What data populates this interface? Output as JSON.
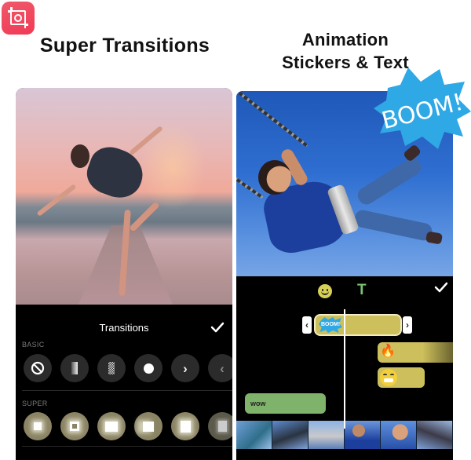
{
  "app": {
    "logo_icon": "instashot-crop-camera-icon"
  },
  "left_feature": {
    "headline": "Super Transitions",
    "sheet_title": "Transitions",
    "confirm_icon": "checkmark-icon",
    "sections": [
      {
        "label": "BASIC",
        "items": [
          {
            "name": "none",
            "icon": "prohibited-icon",
            "glyph": "⃠"
          },
          {
            "name": "fade",
            "icon": "gradient-fade-icon"
          },
          {
            "name": "dissolve",
            "icon": "checker-dissolve-icon"
          },
          {
            "name": "circle",
            "icon": "circle-dot-icon"
          },
          {
            "name": "slide-right",
            "icon": "chevron-right-icon",
            "glyph": "›"
          },
          {
            "name": "slide-left",
            "icon": "chevron-left-icon",
            "glyph": "‹"
          }
        ]
      },
      {
        "label": "SUPER",
        "items": [
          {
            "name": "super-1",
            "icon": "glow-square-icon"
          },
          {
            "name": "super-2",
            "icon": "frame-square-icon"
          },
          {
            "name": "super-3",
            "icon": "glow-rect-icon"
          },
          {
            "name": "super-4",
            "icon": "motion-rect-icon"
          },
          {
            "name": "super-5",
            "icon": "tall-rect-icon"
          },
          {
            "name": "super-6",
            "icon": "blur-rect-icon"
          }
        ]
      }
    ]
  },
  "right_feature": {
    "headline_line1": "Animation",
    "headline_line2": "Stickers & Text",
    "sticker_text": "BOOM!",
    "toolbar": {
      "sticker_tab_icon": "smiley-icon",
      "text_tab_label": "T",
      "confirm_icon": "checkmark-icon"
    },
    "timeline": {
      "trim_left": "‹",
      "trim_right": "›",
      "clips": [
        {
          "type": "sticker",
          "label": "BOOM!",
          "selected": true
        },
        {
          "type": "sticker",
          "emoji": "🔥"
        },
        {
          "type": "sticker",
          "emoji": "grinning-face"
        },
        {
          "type": "text",
          "label": "wow"
        }
      ]
    }
  },
  "colors": {
    "brand": "#f0475f",
    "clip_sticker": "#cdbf5b",
    "clip_text": "#7fb26a",
    "text_tab": "#7bc36f",
    "boom_blue": "#2fa8e6",
    "panel_bg": "#000000"
  }
}
